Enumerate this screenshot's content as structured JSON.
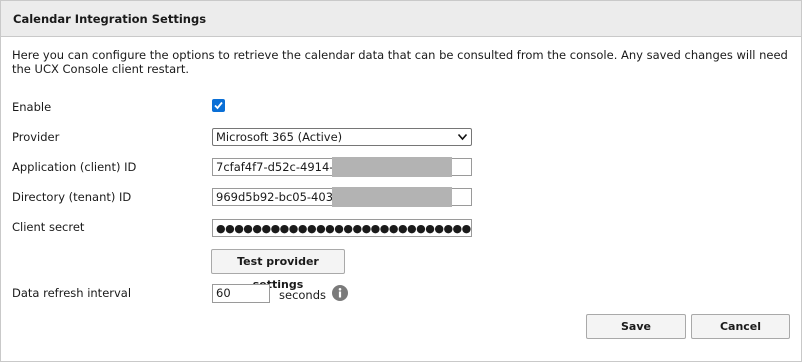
{
  "panel": {
    "title": "Calendar Integration Settings",
    "description": "Here you can configure the options to retrieve the calendar data that can be consulted from the console. Any saved changes will need the UCX Console client restart."
  },
  "form": {
    "enable": {
      "label": "Enable",
      "checked": true
    },
    "provider": {
      "label": "Provider",
      "value": "Microsoft 365 (Active)"
    },
    "application_id": {
      "label": "Application (client) ID",
      "value": "7cfaf4f7-d52c-4914-8"
    },
    "directory_id": {
      "label": "Directory (tenant) ID",
      "value": "969d5b92-bc05-403f"
    },
    "client_secret": {
      "label": "Client secret",
      "value": "●●●●●●●●●●●●●●●●●●●●●●●●●●●●●●●●●●●●●●●●"
    },
    "test_button": "Test provider settings",
    "refresh_interval": {
      "label": "Data refresh interval",
      "value": "60",
      "unit": "seconds"
    }
  },
  "actions": {
    "save": "Save",
    "cancel": "Cancel"
  },
  "colors": {
    "accent": "#0a6fd6",
    "header_bg": "#ececec",
    "redaction": "#b3b3b3"
  }
}
